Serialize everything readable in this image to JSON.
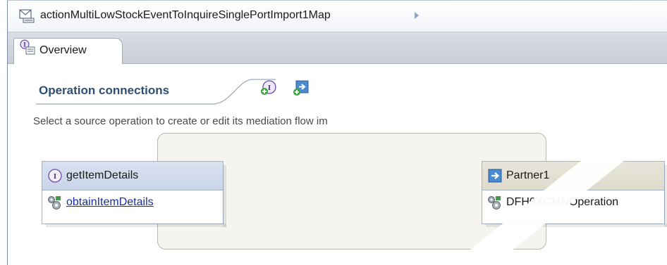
{
  "editor": {
    "title": "actionMultiLowStockEventToInquireSinglePortImport1Map",
    "title_icon": "mediation-map-icon",
    "breadcrumb_arrow_icon": "chevron-right-icon"
  },
  "tabs": [
    {
      "label": "Overview",
      "icon": "interface-tab-icon",
      "selected": true
    }
  ],
  "section": {
    "title": "Operation connections",
    "description": "Select a source operation to create or edit its mediation flow im",
    "toolbar": [
      {
        "icon": "add-interface-icon"
      },
      {
        "icon": "add-reference-icon"
      }
    ]
  },
  "source_operation": {
    "interface_name": "getItemDetails",
    "interface_icon": "interface-icon",
    "operation_name": "obtainItemDetails",
    "operation_icon": "operation-gears-icon"
  },
  "target_operation": {
    "partner_name": "Partner1",
    "partner_icon": "reference-partner-icon",
    "operation_name": "DFH0XCMNOperation",
    "operation_icon": "operation-gears-icon"
  },
  "colors": {
    "section_title": "#2d4f73",
    "link": "#1b2f9c",
    "source_header": "#d0dbec",
    "target_header": "#e2e0d3",
    "panel_bg": "#f5f4ee"
  }
}
